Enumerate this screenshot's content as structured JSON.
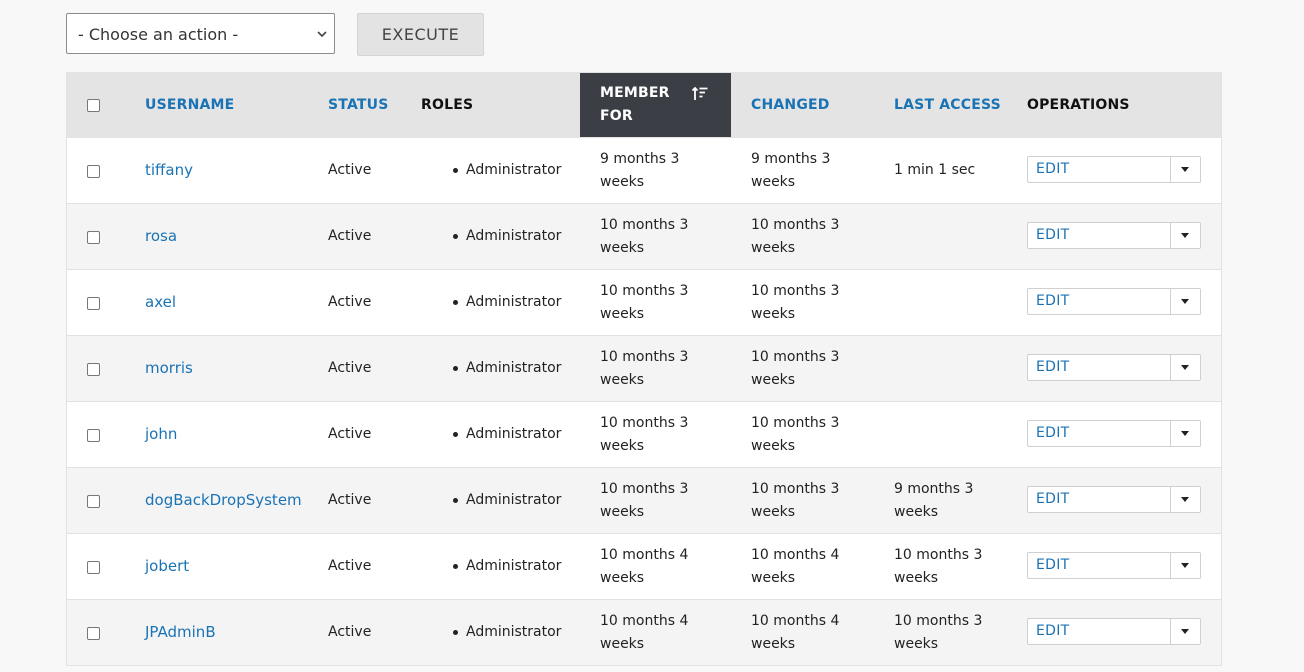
{
  "bulk": {
    "select_value": "- Choose an action -",
    "execute_label": "EXECUTE"
  },
  "table": {
    "headers": {
      "username": "USERNAME",
      "status": "STATUS",
      "roles": "ROLES",
      "member_for": "MEMBER FOR",
      "changed": "CHANGED",
      "last_access": "LAST ACCESS",
      "operations": "OPERATIONS"
    },
    "sorted_column": "member_for",
    "sort_icon": "sort-ascending-icon",
    "edit_label": "EDIT",
    "rows": [
      {
        "username": "tiffany",
        "status": "Active",
        "role": "Administrator",
        "member_for": "9 months 3 weeks",
        "changed": "9 months 3 weeks",
        "last_access": "1 min 1 sec"
      },
      {
        "username": "rosa",
        "status": "Active",
        "role": "Administrator",
        "member_for": "10 months 3 weeks",
        "changed": "10 months 3 weeks",
        "last_access": ""
      },
      {
        "username": "axel",
        "status": "Active",
        "role": "Administrator",
        "member_for": "10 months 3 weeks",
        "changed": "10 months 3 weeks",
        "last_access": ""
      },
      {
        "username": "morris",
        "status": "Active",
        "role": "Administrator",
        "member_for": "10 months 3 weeks",
        "changed": "10 months 3 weeks",
        "last_access": ""
      },
      {
        "username": "john",
        "status": "Active",
        "role": "Administrator",
        "member_for": "10 months 3 weeks",
        "changed": "10 months 3 weeks",
        "last_access": ""
      },
      {
        "username": "dogBackDropSystem",
        "status": "Active",
        "role": "Administrator",
        "member_for": "10 months 3 weeks",
        "changed": "10 months 3 weeks",
        "last_access": "9 months 3 weeks"
      },
      {
        "username": "jobert",
        "status": "Active",
        "role": "Administrator",
        "member_for": "10 months 4 weeks",
        "changed": "10 months 4 weeks",
        "last_access": "10 months 3 weeks"
      },
      {
        "username": "JPAdminB",
        "status": "Active",
        "role": "Administrator",
        "member_for": "10 months 4 weeks",
        "changed": "10 months 4 weeks",
        "last_access": "10 months 3 weeks"
      }
    ]
  },
  "colors": {
    "link": "#1a73b5",
    "header_bg": "#e4e4e4",
    "active_header_bg": "#3b3f45"
  }
}
